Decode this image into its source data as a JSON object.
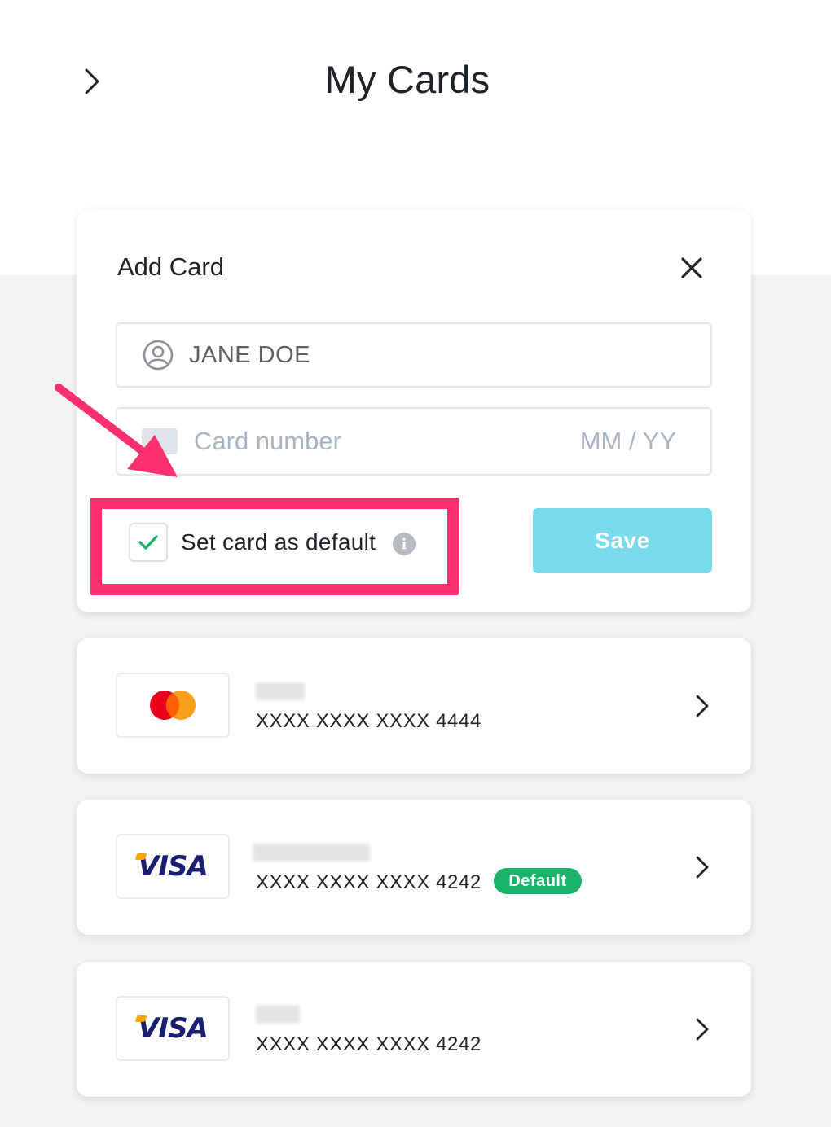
{
  "header": {
    "title": "My Cards",
    "back_icon": "chevron-right-icon"
  },
  "add_card": {
    "title": "Add Card",
    "close_icon": "close-icon",
    "name_field": {
      "icon": "user-circle-icon",
      "value": "JANE DOE"
    },
    "card_field": {
      "icon": "credit-card-icon",
      "number_placeholder": "Card number",
      "expiry_placeholder": "MM / YY"
    },
    "set_default": {
      "label": "Set card as default",
      "checked": true,
      "info_icon": "info-icon"
    },
    "save_label": "Save"
  },
  "annotations": {
    "highlight_color": "#fc306e",
    "arrow_icon": "annotation-arrow-icon"
  },
  "saved_cards": [
    {
      "brand": "mastercard",
      "number": "XXXX XXXX XXXX 4444",
      "is_default": false
    },
    {
      "brand": "visa",
      "number": "XXXX XXXX XXXX 4242",
      "is_default": true,
      "badge": "Default"
    },
    {
      "brand": "visa",
      "number": "XXXX XXXX XXXX 4242",
      "is_default": false
    }
  ],
  "brand_labels": {
    "visa": "VISA"
  },
  "colors": {
    "save_button": "#79dbec",
    "default_badge": "#1bb36b",
    "checkmark": "#1bb36b",
    "page_background": "#f3f3f4"
  }
}
